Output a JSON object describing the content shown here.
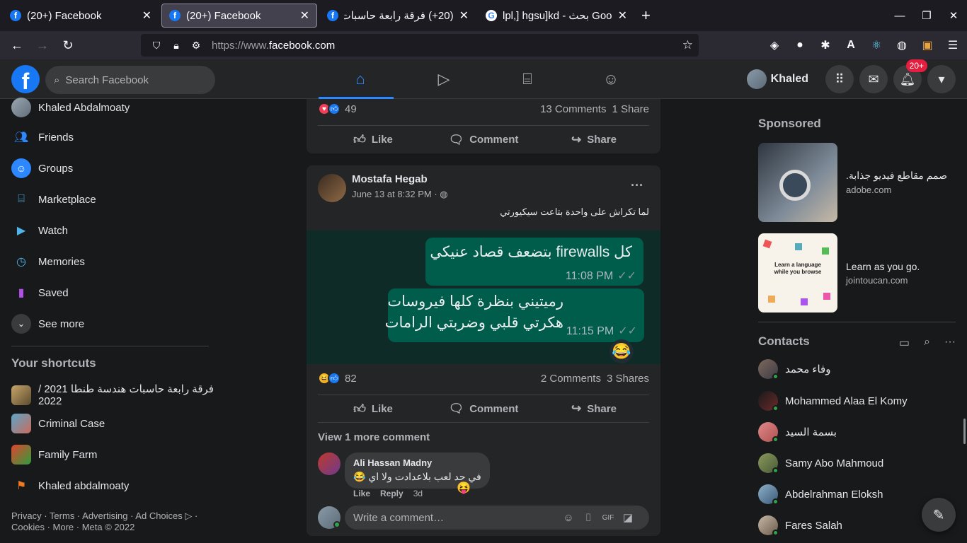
{
  "browser": {
    "tabs": [
      {
        "title": "(20+) Facebook",
        "icon": "facebook-icon"
      },
      {
        "title": "(20+) Facebook",
        "icon": "facebook-icon"
      },
      {
        "title": "(20+) فرقة رابعة حاسبات",
        "icon": "facebook-icon"
      },
      {
        "title": "lpl,] hgsu]kd - بحث Google",
        "icon": "google-icon"
      }
    ],
    "url_prefix": "https://www.",
    "url_domain": "facebook.com"
  },
  "header": {
    "search_placeholder": "Search Facebook",
    "profile_name": "Khaled",
    "notifications_badge": "20+"
  },
  "sidebar": {
    "items": [
      {
        "label": "Khaled Abdalmoaty"
      },
      {
        "label": "Friends"
      },
      {
        "label": "Groups"
      },
      {
        "label": "Marketplace"
      },
      {
        "label": "Watch"
      },
      {
        "label": "Memories"
      },
      {
        "label": "Saved"
      },
      {
        "label": "See more"
      }
    ],
    "shortcuts_title": "Your shortcuts",
    "shortcuts": [
      {
        "label": "فرقة رابعة حاسبات هندسة طنطا 2021 / 2022"
      },
      {
        "label": "Criminal Case"
      },
      {
        "label": "Family Farm"
      },
      {
        "label": "Khaled abdalmoaty"
      }
    ],
    "footer_line1": "Privacy · Terms · Advertising · Ad Choices ▷ ·",
    "footer_line2": "Cookies · More · Meta © 2022"
  },
  "post1": {
    "reactions_count": "49",
    "comments": "13 Comments",
    "shares": "1 Share"
  },
  "actions": {
    "like": "Like",
    "comment": "Comment",
    "share": "Share"
  },
  "post2": {
    "author": "Mostafa Hegab",
    "time": "June 13 at 8:32 PM · ",
    "text": "لما تكراش على واحدة بتاعت سيكيورتي",
    "image": {
      "bubble1_text": "كل firewalls بتضعف قصاد عنيكي",
      "bubble1_time": "11:08 PM",
      "bubble2_line1": "رميتيني بنظرة كلها فيروسات",
      "bubble2_line2": "هكرتي قلبي وضربتي الرامات",
      "bubble2_time": "11:15 PM",
      "reaction": "😂"
    },
    "reactions_count": "82",
    "comments": "2 Comments",
    "shares": "3 Shares",
    "view_more": "View 1 more comment",
    "comment": {
      "author": "Ali Hassan Madny",
      "text": "في حد لعب بلاعدادت ولا اي 😂",
      "reaction": "😝",
      "like": "Like",
      "reply": "Reply",
      "age": "3d"
    },
    "comment_placeholder": "Write a comment…"
  },
  "right": {
    "sponsored_title": "Sponsored",
    "ads": [
      {
        "title": "صمم مقاطع فيديو جذابة.",
        "host": "adobe.com"
      },
      {
        "title": "Learn as you go.",
        "host": "jointoucan.com"
      }
    ],
    "ad2_image_text": "Learn a language while you browse",
    "contacts_title": "Contacts",
    "contacts": [
      {
        "name": "وفاء محمد"
      },
      {
        "name": "Mohammed Alaa El Komy"
      },
      {
        "name": "بسمة السيد"
      },
      {
        "name": "Samy Abo Mahmoud"
      },
      {
        "name": "Abdelrahman Eloksh"
      },
      {
        "name": "Fares Salah"
      }
    ]
  },
  "colors": {
    "accent": "#2d88ff",
    "fb_blue": "#1877f2",
    "badge": "#e41e3f",
    "online": "#31a24c",
    "bubble": "#005c4b"
  }
}
